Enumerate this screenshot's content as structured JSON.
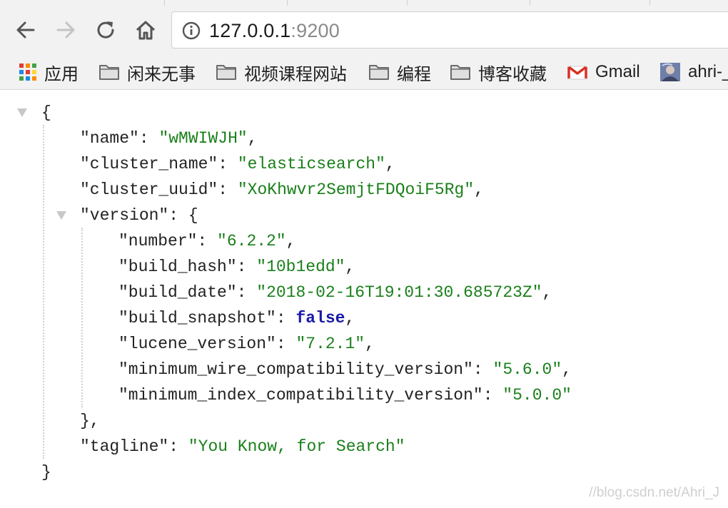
{
  "browser": {
    "address_bar": {
      "host": "127.0.0.1",
      "port": ":9200"
    },
    "icons": [
      "back-arrow-icon",
      "forward-arrow-icon",
      "reload-icon",
      "home-icon",
      "info-icon"
    ]
  },
  "bookmarks": [
    {
      "label": "应用",
      "icon": "apps-grid-icon"
    },
    {
      "label": "闲来无事",
      "icon": "folder-icon"
    },
    {
      "label": "视频课程网站",
      "icon": "folder-icon"
    },
    {
      "label": "编程",
      "icon": "folder-icon"
    },
    {
      "label": "博客收藏",
      "icon": "folder-icon"
    },
    {
      "label": "Gmail",
      "icon": "gmail-icon"
    },
    {
      "label": "ahri-_",
      "icon": "avatar-icon"
    }
  ],
  "response": {
    "name": "wMWIWJH",
    "cluster_name": "elasticsearch",
    "cluster_uuid": "XoKhwvr2SemjtFDQoiF5Rg",
    "version": {
      "number": "6.2.2",
      "build_hash": "10b1edd",
      "build_date": "2018-02-16T19:01:30.685723Z",
      "build_snapshot": "false",
      "lucene_version": "7.2.1",
      "minimum_wire_compatibility_version": "5.6.0",
      "minimum_index_compatibility_version": "5.0.0"
    },
    "tagline": "You Know, for Search"
  },
  "keys": {
    "name": "\"name\"",
    "cluster_name": "\"cluster_name\"",
    "cluster_uuid": "\"cluster_uuid\"",
    "version": "\"version\"",
    "number": "\"number\"",
    "build_hash": "\"build_hash\"",
    "build_date": "\"build_date\"",
    "build_snapshot": "\"build_snapshot\"",
    "lucene_version": "\"lucene_version\"",
    "minimum_wire_compatibility_version": "\"minimum_wire_compatibility_version\"",
    "minimum_index_compatibility_version": "\"minimum_index_compatibility_version\"",
    "tagline": "\"tagline\""
  },
  "watermark": "//blog.csdn.net/Ahri_J"
}
